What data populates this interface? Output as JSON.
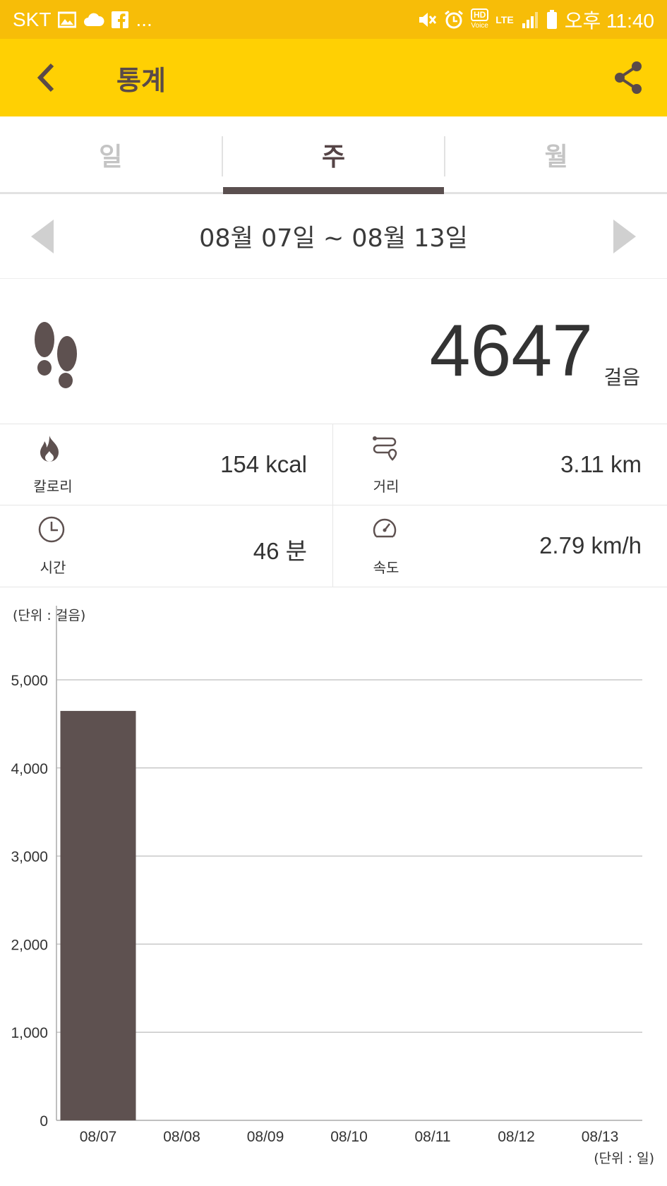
{
  "status_bar": {
    "carrier": "SKT",
    "more": "...",
    "hd_label": "HD",
    "voice_label": "Voice",
    "lte_label": "LTE",
    "time": "오후 11:40"
  },
  "app_bar": {
    "title": "통계",
    "back_icon": "chevron-left-icon",
    "share_icon": "share-icon",
    "color": "#ffd003"
  },
  "tabs": [
    {
      "label": "일",
      "active": false
    },
    {
      "label": "주",
      "active": true
    },
    {
      "label": "월",
      "active": false
    }
  ],
  "date_nav": {
    "range": "08월 07일 ~ 08월 13일"
  },
  "steps": {
    "value": "4647",
    "unit": "걸음"
  },
  "stats": {
    "calories": {
      "label": "칼로리",
      "value": "154 kcal",
      "icon": "flame-icon"
    },
    "distance": {
      "label": "거리",
      "value": "3.11 km",
      "icon": "route-icon"
    },
    "time": {
      "label": "시간",
      "value": "46 분",
      "icon": "clock-icon"
    },
    "speed": {
      "label": "속도",
      "value": "2.79 km/h",
      "icon": "speedometer-icon"
    }
  },
  "chart": {
    "unit_top": "(단위 : 걸음)",
    "unit_bottom": "(단위 : 일)"
  },
  "chart_data": {
    "type": "bar",
    "categories": [
      "08/07",
      "08/08",
      "08/09",
      "08/10",
      "08/11",
      "08/12",
      "08/13"
    ],
    "values": [
      4647,
      0,
      0,
      0,
      0,
      0,
      0
    ],
    "ylim": [
      0,
      5000
    ],
    "yticks": [
      0,
      1000,
      2000,
      3000,
      4000,
      5000
    ],
    "ytick_labels": [
      "0",
      "1,000",
      "2,000",
      "3,000",
      "4,000",
      "5,000"
    ],
    "grid": true,
    "bar_color": "#5e5150"
  }
}
